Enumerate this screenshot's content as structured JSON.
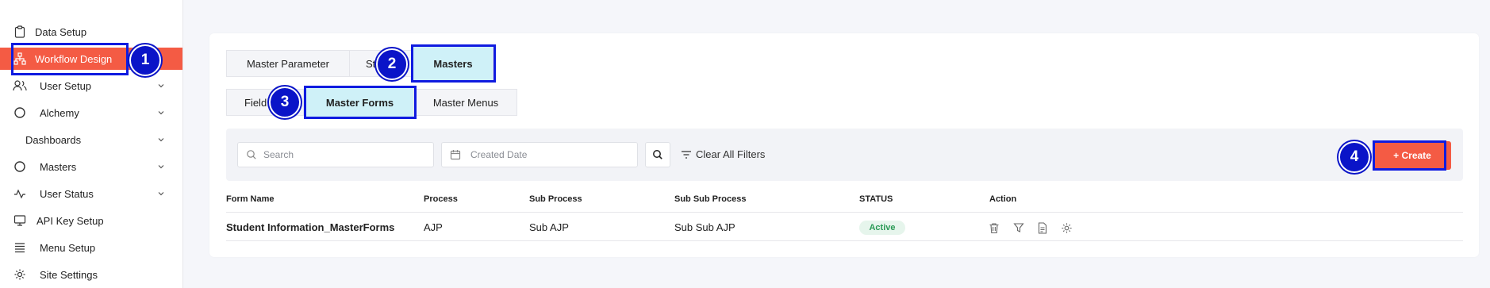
{
  "sidebar": {
    "items": [
      {
        "label": "Data Setup",
        "icon": "clipboard-icon",
        "chevron": false
      },
      {
        "label": "Workflow Design",
        "icon": "sitemap-icon",
        "chevron": false,
        "active": true
      },
      {
        "label": "User Setup",
        "icon": "users-icon",
        "chevron": true
      },
      {
        "label": "Alchemy",
        "icon": "circle-icon",
        "chevron": true
      },
      {
        "label": "Dashboards",
        "icon": "",
        "chevron": true
      },
      {
        "label": "Masters",
        "icon": "circle-icon",
        "chevron": true
      },
      {
        "label": "User Status",
        "icon": "activity-icon",
        "chevron": true
      },
      {
        "label": "API Key Setup",
        "icon": "monitor-icon",
        "chevron": false
      },
      {
        "label": "Menu Setup",
        "icon": "list-icon",
        "chevron": false
      },
      {
        "label": "Site Settings",
        "icon": "gear-icon",
        "chevron": false
      }
    ]
  },
  "tabs_row1": [
    {
      "label": "Master Parameter"
    },
    {
      "label": "St"
    },
    {
      "label": "Masters",
      "selected": true
    }
  ],
  "tabs_row2": [
    {
      "label": "Field"
    },
    {
      "label": "Master Forms",
      "selected": true
    },
    {
      "label": "Master Menus"
    }
  ],
  "badges": [
    "1",
    "2",
    "3",
    "4"
  ],
  "filters": {
    "search_placeholder": "Search",
    "date_placeholder": "Created Date",
    "clear_label": "Clear All Filters"
  },
  "create_label": "+ Create",
  "table": {
    "headers": [
      "Form Name",
      "Process",
      "Sub Process",
      "Sub Sub Process",
      "STATUS",
      "Action"
    ],
    "rows": [
      {
        "form_name": "Student Information_MasterForms",
        "process": "AJP",
        "sub_process": "Sub AJP",
        "sub_sub_process": "Sub Sub AJP",
        "status": "Active"
      }
    ]
  },
  "colors": {
    "accent": "#f45b44",
    "selected_tab": "#cff1f8",
    "annotation": "#0a14c8",
    "status_active": "#2a9a55"
  }
}
